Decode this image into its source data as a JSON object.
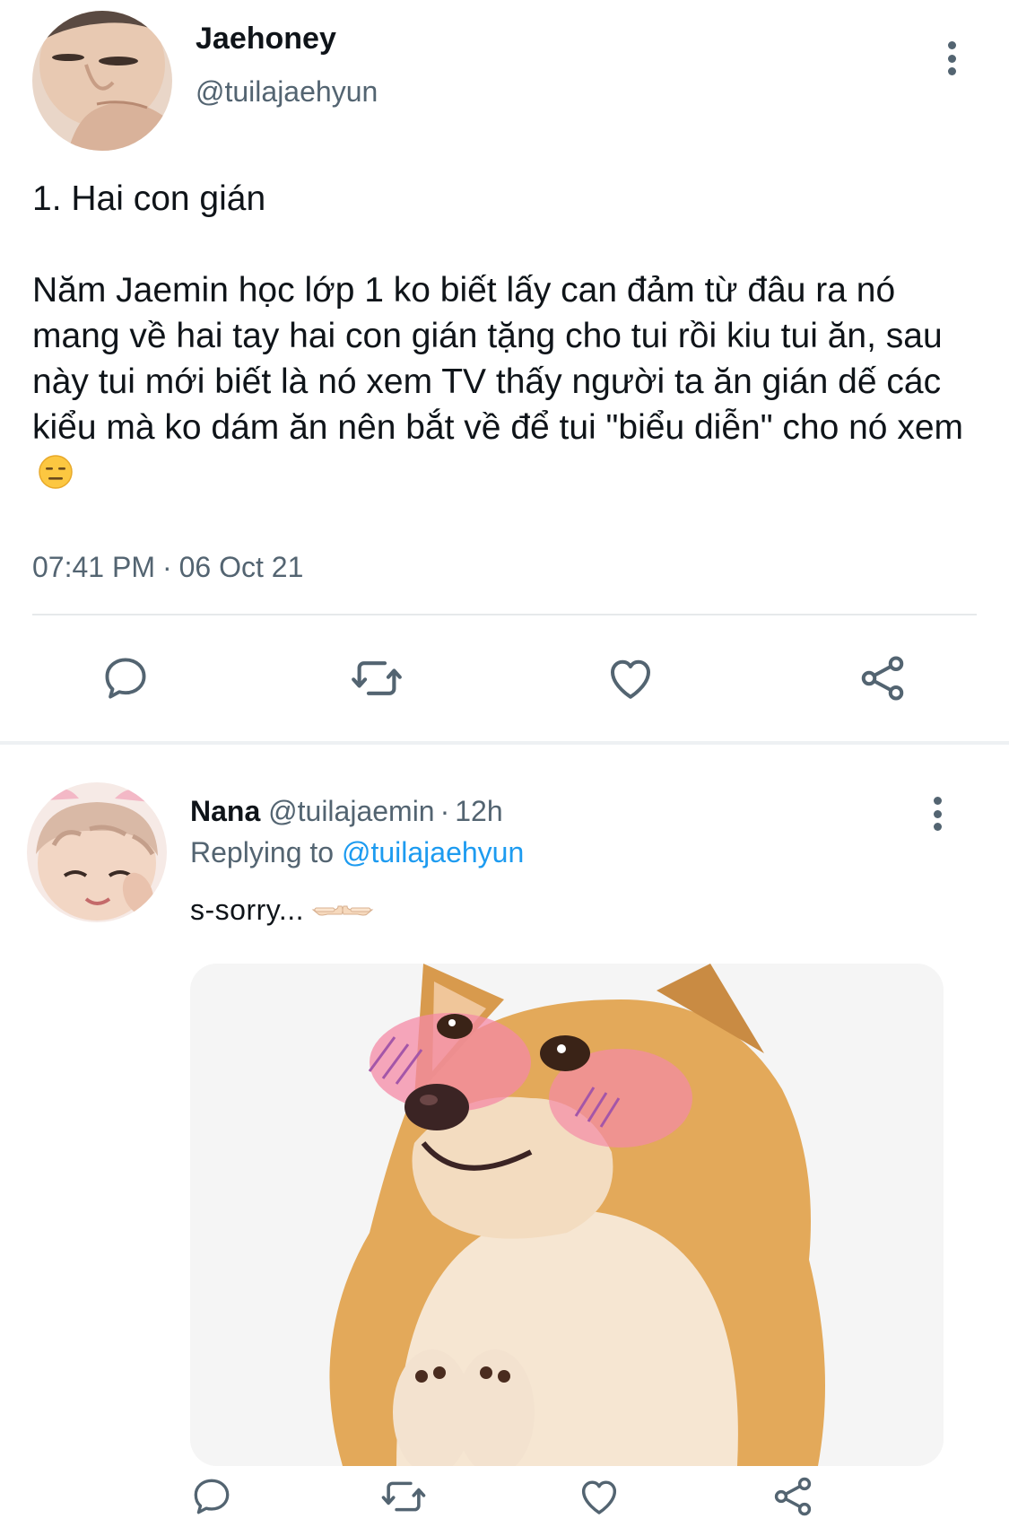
{
  "main_tweet": {
    "display_name": "Jaehoney",
    "handle": "@tuilajaehyun",
    "heading": "1. Hai con gián",
    "body": "Năm Jaemin học lớp 1 ko biết lấy can đảm từ đâu ra nó mang về hai tay hai con gián tặng cho tui rồi kiu tui ăn, sau này tui mới biết là nó xem TV thấy người ta ăn gián dế các kiểu mà ko dám ăn nên bắt về để tui \"biểu diễn\" cho nó xem",
    "body_emoji": "expressionless-face-emoji",
    "time": "07:41 PM",
    "time_separator": "·",
    "date": "06 Oct 21",
    "actions": [
      "reply-icon",
      "retweet-icon",
      "like-icon",
      "share-icon"
    ]
  },
  "reply": {
    "display_name": "Nana",
    "handle": "@tuilajaemin",
    "separator": "·",
    "age": "12h",
    "replying_prefix": "Replying to",
    "replying_to": "@tuilajaehyun",
    "text": "s-sorry...",
    "text_emoji": "pointing-fingers-emoji",
    "media": "shiba-doge-blushing-meme",
    "actions": [
      "reply-icon",
      "retweet-icon",
      "like-icon",
      "share-icon"
    ]
  },
  "colors": {
    "text_primary": "#0f1419",
    "text_secondary": "#536471",
    "link": "#1d9bf0",
    "divider": "#e6e9eb",
    "icon": "#536471"
  }
}
